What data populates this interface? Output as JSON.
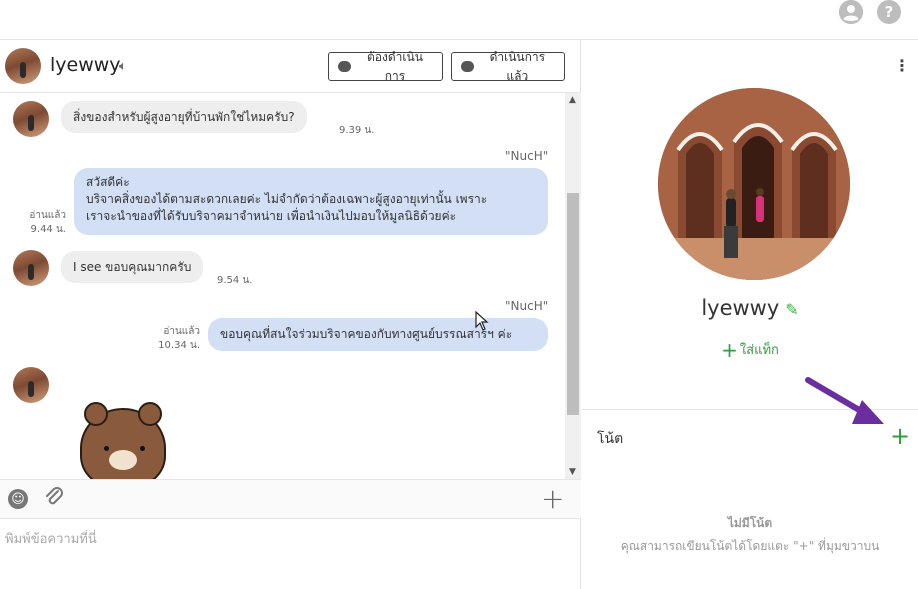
{
  "topbar": {
    "account_icon": "account-circle-icon",
    "help_icon": "help-icon",
    "help_glyph": "?"
  },
  "chat": {
    "contact_name": "lyewwy",
    "buttons": {
      "todo": "ต้องดำเนินการ",
      "done": "ดำเนินการแล้ว"
    },
    "messages": [
      {
        "text": "สิ่งของสำหรับผู้สูงอายุที่บ้านพักใช่ไหมครับ?",
        "time": "9.39 น."
      },
      {
        "sender": "\"NucH\"",
        "lines": [
          "สวัสดีค่ะ",
          "บริจาคสิ่งของได้ตามสะดวกเลยค่ะ ไม่จำกัดว่าต้องเฉพาะผู้สูงอายุเท่านั้น เพราะ",
          "เราจะนำของที่ได้รับบริจาคมาจำหน่าย เพื่อนำเงินไปมอบให้มูลนิธิด้วยค่ะ"
        ],
        "read": "อ่านแล้ว",
        "time": "9.44 น."
      },
      {
        "text": "I see ขอบคุณมากครับ",
        "time": "9.54 น."
      },
      {
        "sender": "\"NucH\"",
        "text": "ขอบคุณที่สนใจร่วมบริจาคของกับทางศูนย์บรรณสารฯ ค่ะ",
        "read": "อ่านแล้ว",
        "time": "10.34 น."
      }
    ],
    "composer_placeholder": "พิมพ์ข้อความที่นี่"
  },
  "profile": {
    "name": "lyewwy",
    "add_tag": "ใส่แท็ก",
    "notes_label": "โน้ต",
    "empty_title": "ไม่มีโน้ต",
    "empty_sub": "คุณสามารถเขียนโน้ตได้โดยแตะ \"+\" ที่มุมขวาบน"
  },
  "colors": {
    "accent_green": "#2e9e3b",
    "outgoing_bubble": "#d2dff5",
    "incoming_bubble": "#eeeeee",
    "annotation_arrow": "#6a2ea0"
  }
}
